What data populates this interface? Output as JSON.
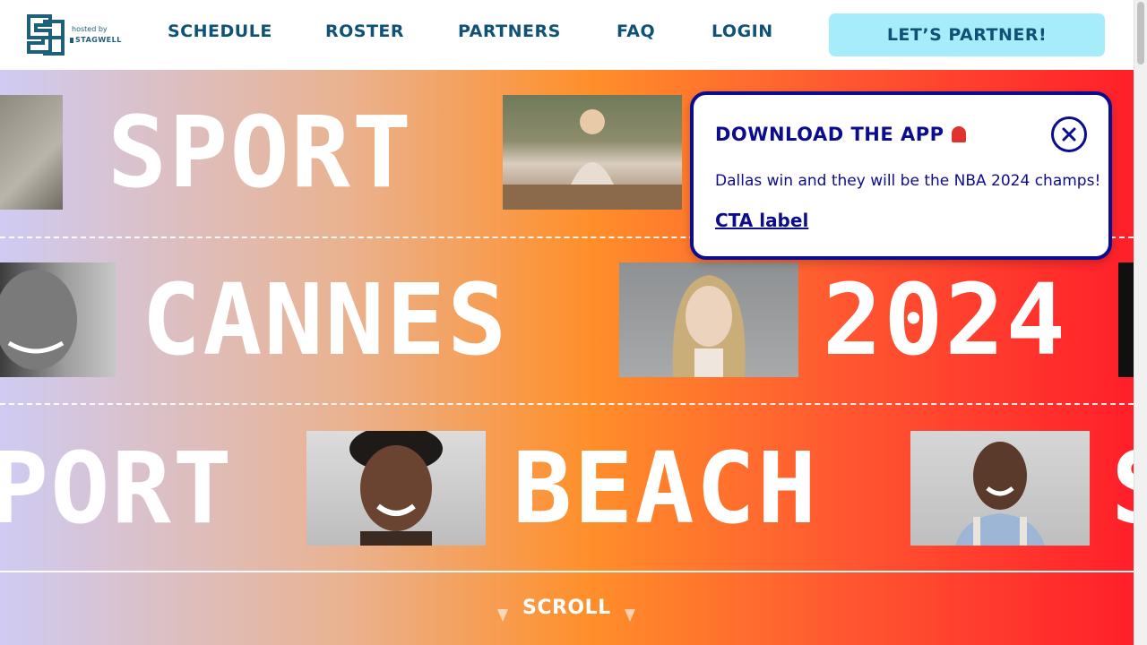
{
  "header": {
    "logo_hosted_by": "hosted by",
    "logo_brand": "STAGWELL",
    "nav": [
      {
        "label": "SCHEDULE"
      },
      {
        "label": "ROSTER"
      },
      {
        "label": "PARTNERS"
      },
      {
        "label": "FAQ"
      },
      {
        "label": "LOGIN"
      }
    ],
    "cta_label": "LET’S PARTNER!"
  },
  "hero": {
    "row1_word": "SPORT",
    "row2_word_a": "CANNES",
    "row2_word_b": "2024",
    "row3_word_a": "PORT",
    "row3_word_b": "BEACH",
    "row3_word_c": "S",
    "scroll_label": "SCROLL"
  },
  "popup": {
    "title": "DOWNLOAD THE APP",
    "title_icon": "siren-icon",
    "body": "Dallas win and they will be the NBA 2024 champs!",
    "cta": "CTA label",
    "close_icon": "close-icon"
  },
  "colors": {
    "brand_dark": "#0f5276",
    "accent_cyan": "#a6ecfb",
    "popup_border": "#0c0c8e"
  }
}
